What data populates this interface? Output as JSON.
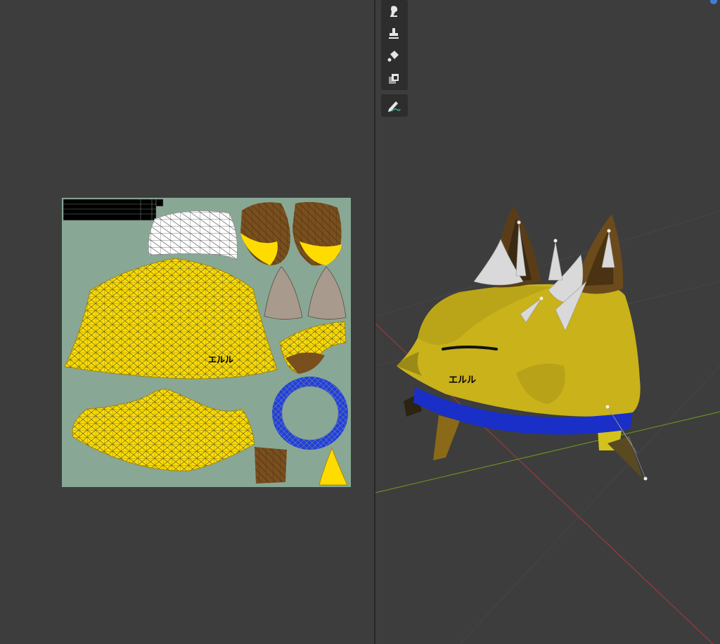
{
  "uv_editor": {
    "texture_label": "エルル",
    "colors": {
      "background": "#88a895",
      "body_yellow": "#ffdc00",
      "ear_brown": "#7a4f1e",
      "ear_inner": "#a89a8c",
      "collar_blue": "#1f3fd9",
      "wire": "#3a4a3a"
    }
  },
  "viewport": {
    "model_label": "エルル",
    "toolbar": {
      "tools": [
        {
          "name": "draw-tool",
          "icon": "brush-icon"
        },
        {
          "name": "clone-tool",
          "icon": "stamp-icon"
        },
        {
          "name": "fill-tool",
          "icon": "bucket-icon"
        },
        {
          "name": "mask-tool",
          "icon": "mask-icon"
        },
        {
          "name": "annotate-tool",
          "icon": "pencil-icon"
        }
      ]
    },
    "colors": {
      "x_axis": "#9a3b3b",
      "y_axis": "#6b8e23",
      "body": "#c9b21a",
      "collar": "#1a2fc7"
    }
  }
}
